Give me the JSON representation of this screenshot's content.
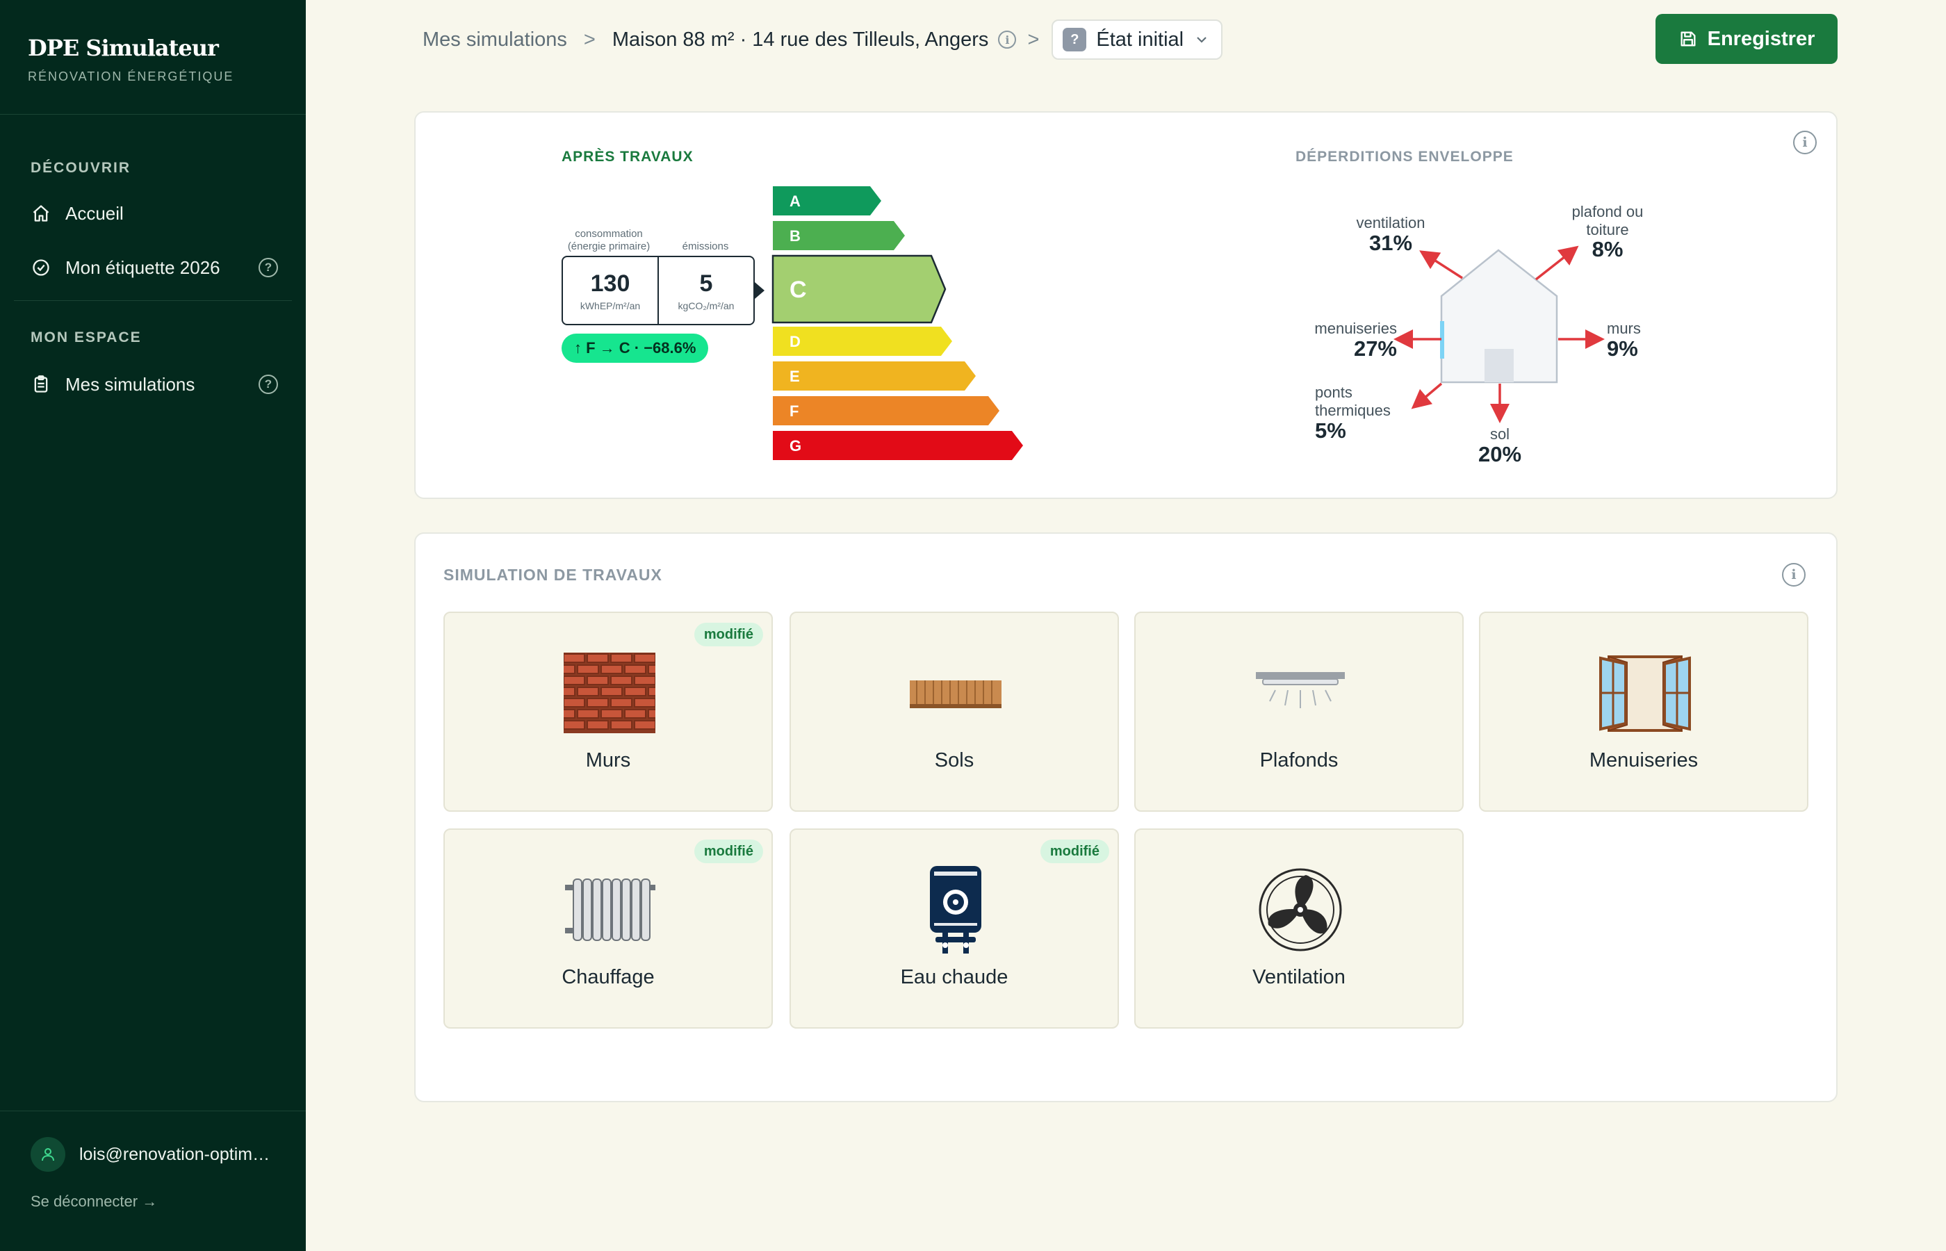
{
  "sidebar": {
    "brand": "DPE Simulateur",
    "brand_sub": "RÉNOVATION ÉNERGÉTIQUE",
    "sections": [
      {
        "title": "DÉCOUVRIR",
        "items": [
          {
            "label": "Accueil",
            "icon": "home-icon"
          },
          {
            "label": "Mon étiquette 2026",
            "icon": "check-circle-icon",
            "help": "?"
          }
        ]
      },
      {
        "title": "MON ESPACE",
        "items": [
          {
            "label": "Mes simulations",
            "icon": "clipboard-icon",
            "help": "?"
          }
        ]
      }
    ],
    "user_email": "lois@renovation-optim…",
    "logout": "Se déconnecter →"
  },
  "header": {
    "breadcrumb_root": "Mes simulations",
    "separator": ">",
    "property": "Maison 88 m² · 14 rue des Tilleuls, Angers",
    "state_icon": "?",
    "state_value": "État initial",
    "save_label": "Enregistrer"
  },
  "energy_card": {
    "label": "APRÈS TRAVAUX",
    "consumption_label_1": "consommation",
    "consumption_label_2": "(énergie primaire)",
    "emissions_label": "émissions",
    "consumption_value": "130",
    "consumption_unit": "kWhEP/m²/an",
    "emissions_value": "5",
    "emissions_unit": "kgCO₂/m²/an",
    "gain": "↑ F → C · −68.6%",
    "current_class": "C",
    "classes": [
      {
        "letter": "A",
        "color": "#0f9a5c"
      },
      {
        "letter": "B",
        "color": "#4caf50"
      },
      {
        "letter": "C",
        "color": "#a3cf70"
      },
      {
        "letter": "D",
        "color": "#f0e020"
      },
      {
        "letter": "E",
        "color": "#f0b420"
      },
      {
        "letter": "F",
        "color": "#ec8526"
      },
      {
        "letter": "G",
        "color": "#e20b17"
      }
    ]
  },
  "losses_card": {
    "label": "DÉPERDITIONS ENVELOPPE",
    "items": [
      {
        "key": "ventilation",
        "label": "ventilation",
        "value": "31%"
      },
      {
        "key": "roof",
        "label_1": "plafond ou",
        "label_2": "toiture",
        "value": "8%"
      },
      {
        "key": "windows",
        "label": "menuiseries",
        "value": "27%"
      },
      {
        "key": "walls",
        "label": "murs",
        "value": "9%"
      },
      {
        "key": "bridges",
        "label_1": "ponts",
        "label_2": "thermiques",
        "value": "5%"
      },
      {
        "key": "floor",
        "label": "sol",
        "value": "20%"
      }
    ],
    "arrow_color": "#e0393e"
  },
  "works": {
    "title": "SIMULATION DE TRAVAUX",
    "modified_label": "modifié",
    "tiles": [
      {
        "name": "Murs",
        "icon": "brick-wall-icon",
        "modified": true
      },
      {
        "name": "Sols",
        "icon": "wood-floor-icon",
        "modified": false
      },
      {
        "name": "Plafonds",
        "icon": "ceiling-light-icon",
        "modified": false
      },
      {
        "name": "Menuiseries",
        "icon": "window-icon",
        "modified": false
      },
      {
        "name": "Chauffage",
        "icon": "radiator-icon",
        "modified": true
      },
      {
        "name": "Eau chaude",
        "icon": "water-heater-icon",
        "modified": true
      },
      {
        "name": "Ventilation",
        "icon": "fan-icon",
        "modified": false
      }
    ]
  }
}
